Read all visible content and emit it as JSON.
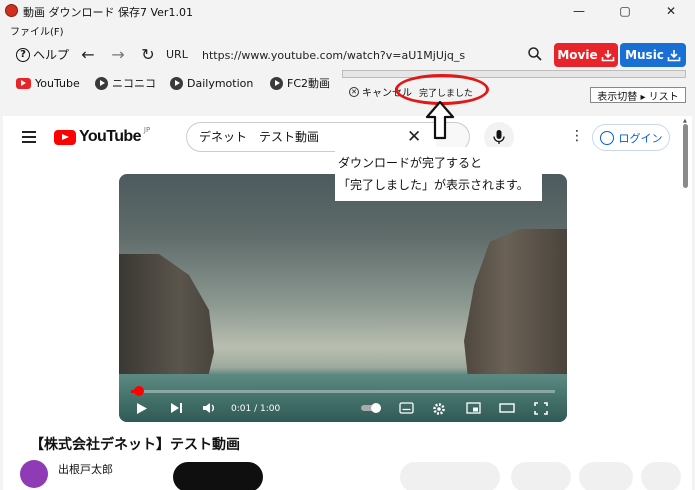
{
  "window": {
    "title": "動画 ダウンロード 保存7 Ver1.01",
    "minimize": "—",
    "maximize": "▢",
    "close": "✕"
  },
  "menu": {
    "file": "ファイル(F)"
  },
  "toolbar": {
    "help": "ヘルプ",
    "url_label": "URL",
    "url_value": "https://www.youtube.com/watch?v=aU1MjUjq_s",
    "movie_label": "Movie",
    "music_label": "Music",
    "accent_movie": "#e8242a",
    "accent_music": "#1a6fd4"
  },
  "bookmarks": [
    {
      "label": "YouTube",
      "icon": "youtube-icon"
    },
    {
      "label": "ニコニコ",
      "icon": "play-circle-icon"
    },
    {
      "label": "Dailymotion",
      "icon": "play-circle-icon"
    },
    {
      "label": "FC2動画",
      "icon": "play-circle-icon"
    }
  ],
  "download": {
    "cancel_label": "キャンセル",
    "status": "完了しました",
    "view_toggle": "表示切替 ▸ リスト"
  },
  "annotation": {
    "line1": "ダウンロードが完了すると",
    "line2": "「完了しました」が表示されます。"
  },
  "youtube": {
    "logo": "YouTube",
    "region": "JP",
    "search_value": "デネット　テスト動画",
    "login": "ログイン",
    "video_time": "0:01 / 1:00",
    "video_progress": 0.017,
    "video_title": "【株式会社デネット】テスト動画",
    "channel_name": "出根戸太郎"
  }
}
